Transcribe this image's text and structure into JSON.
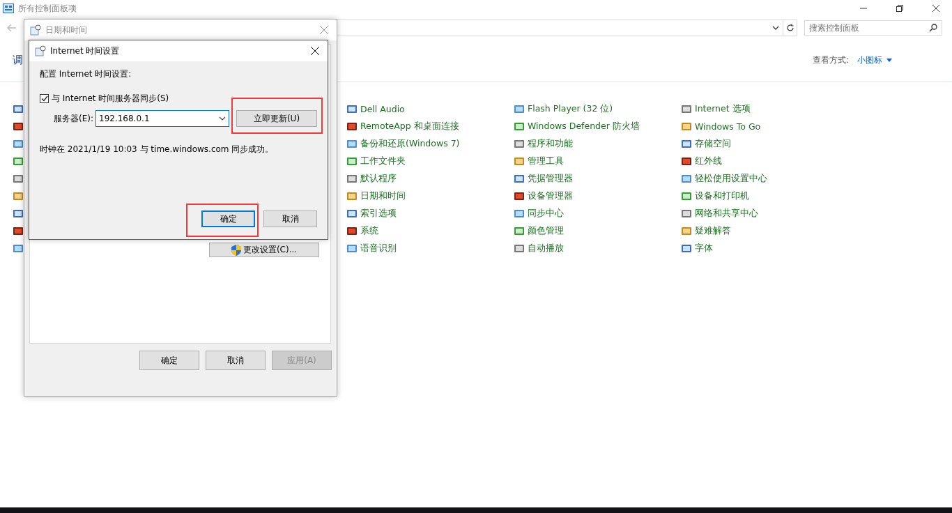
{
  "window": {
    "title": "所有控制面板项"
  },
  "search": {
    "placeholder": "搜索控制面板"
  },
  "heading": "调",
  "view": {
    "label": "查看方式:",
    "value": "小图标"
  },
  "item_columns": [
    [
      "Dell Audio",
      "RemoteApp 和桌面连接",
      "备份和还原(Windows 7)",
      "工作文件夹",
      "默认程序",
      "日期和时间",
      "索引选项",
      "系统",
      "语音识别"
    ],
    [
      "Flash Player (32 位)",
      "Windows Defender 防火墙",
      "程序和功能",
      "管理工具",
      "凭据管理器",
      "设备管理器",
      "同步中心",
      "颜色管理",
      "自动播放"
    ],
    [
      "Internet 选项",
      "Windows To Go",
      "存储空间",
      "红外线",
      "轻松使用设置中心",
      "设备和打印机",
      "网络和共享中心",
      "疑难解答",
      "字体"
    ]
  ],
  "datetime_dialog": {
    "title": "日期和时间",
    "change_button": "更改设置(C)...",
    "buttons": [
      {
        "label": "确定",
        "disabled": false
      },
      {
        "label": "取消",
        "disabled": false
      },
      {
        "label": "应用(A)",
        "disabled": true
      }
    ]
  },
  "internet_dialog": {
    "title": "Internet 时间设置",
    "heading": "配置 Internet 时间设置:",
    "sync": {
      "label": "与 Internet 时间服务器同步(S)",
      "checked": true
    },
    "server_label": "服务器(E):",
    "server_value": "192.168.0.1",
    "update_button": {
      "label": "立即更新(U)",
      "highlighted": true
    },
    "status": "时钟在 2021/1/19 10:03 与 time.windows.com 同步成功。",
    "buttons": [
      {
        "label": "确定",
        "default": true,
        "highlighted": true
      },
      {
        "label": "取消",
        "default": false,
        "highlighted": false
      }
    ]
  }
}
